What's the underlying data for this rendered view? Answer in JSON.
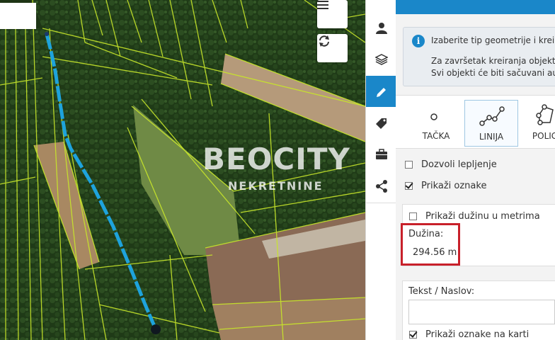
{
  "watermark": {
    "brand": "BEOCITY",
    "sub": "NEKRETNINE"
  },
  "map": {
    "menu_button": "menu-icon",
    "refresh_button": "refresh-icon"
  },
  "toolbar": {
    "tools": [
      "user-icon",
      "layers-icon",
      "pencil-icon",
      "tag-icon",
      "briefcase-icon",
      "share-icon"
    ],
    "active_tool": "pencil-icon"
  },
  "panel": {
    "info_line1": "Izaberite tip geometrije i kreira",
    "info_line2": "Za završetak kreiranja objekta",
    "info_line3": "Svi objekti će biti sačuvani auto",
    "geometry_types": [
      {
        "label": "TAČKA"
      },
      {
        "label": "LINIJA"
      },
      {
        "label": "POLIG"
      }
    ],
    "selected_geometry": "LINIJA",
    "allow_snap": {
      "label": "Dozvoli lepljenje",
      "checked": false
    },
    "show_labels": {
      "label": "Prikaži oznake",
      "checked": true
    },
    "show_length": {
      "label": "Prikaži dužinu u metrima",
      "checked": false
    },
    "length_label": "Dužina:",
    "length_value": "294.56 m",
    "text_title_label": "Tekst / Naslov:",
    "text_title_value": "",
    "show_labels_on_map": {
      "label": "Prikaži oznake na karti",
      "checked": true
    }
  },
  "colors": {
    "accent": "#1a87c9",
    "parcel_lines": "#c8e62a",
    "drawn_line": "#1ea3dc",
    "highlight": "#c8202a"
  }
}
